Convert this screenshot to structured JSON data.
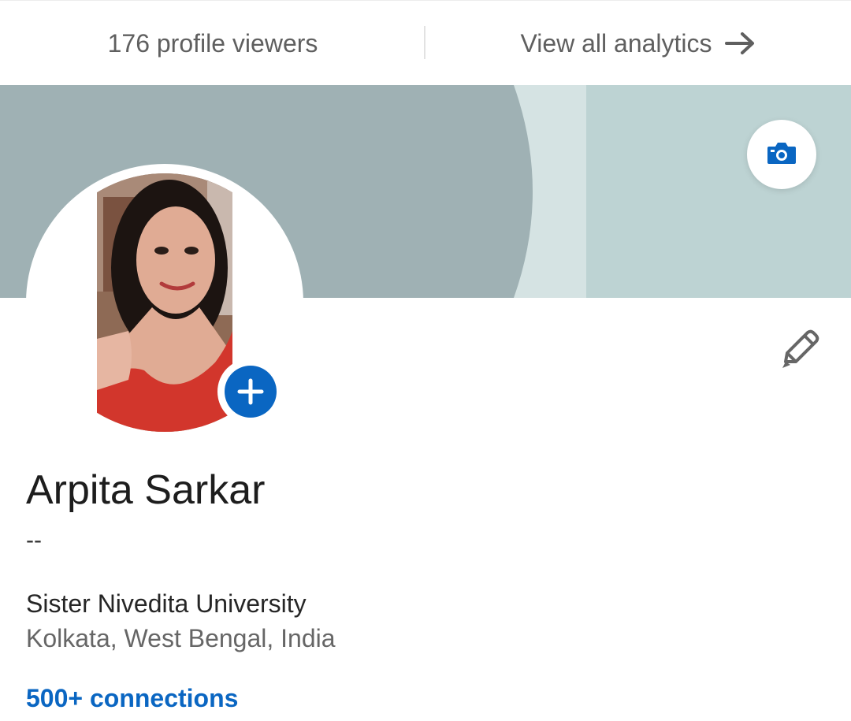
{
  "topbar": {
    "viewers_label": "176 profile viewers",
    "analytics_label": "View all analytics",
    "analytics_icon": "arrow-right-icon"
  },
  "banner": {
    "colors": {
      "main": "#9fb1b4",
      "stripe": "#d5e3e3",
      "right": "#bdd3d3"
    },
    "camera_icon": "camera-icon"
  },
  "profile": {
    "name": "Arpita Sarkar",
    "headline": "--",
    "school": "Sister Nivedita University",
    "location": "Kolkata, West Bengal, India",
    "connections": "500+ connections",
    "add_icon": "plus-icon",
    "edit_icon": "pencil-icon"
  },
  "colors": {
    "accent": "#0a66c2",
    "text_primary": "#1d1d1d",
    "text_secondary": "#666666"
  }
}
